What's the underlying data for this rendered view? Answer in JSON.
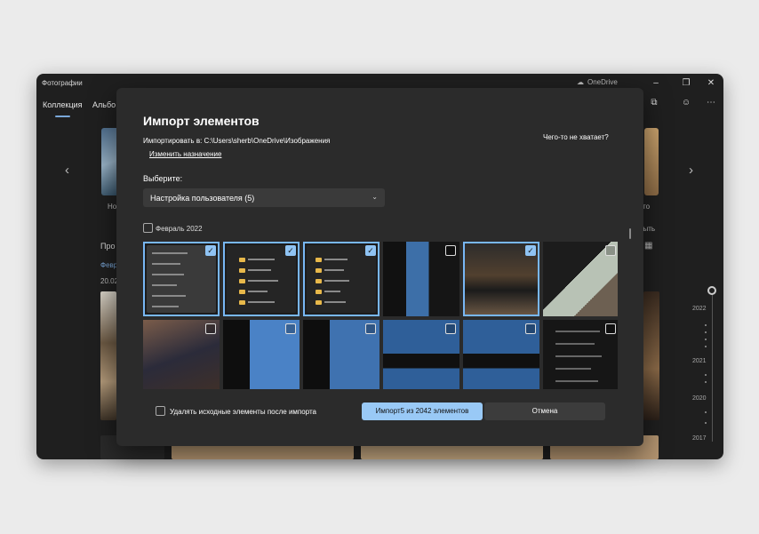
{
  "app": {
    "title": "Фотографии",
    "cloud_label": "OneDrive",
    "tabs": [
      {
        "label": "Коллекция",
        "active": true
      },
      {
        "label": "Альбо"
      }
    ],
    "strip": {
      "left_caption": "Но",
      "right_caption": "то"
    },
    "section_label": "Про",
    "month_link": "Февр",
    "date_label": "20.02",
    "view_label": "рыть",
    "timeline_years": [
      "2022",
      "2021",
      "2020",
      "2017"
    ]
  },
  "dialog": {
    "title": "Импорт элементов",
    "destination_label": "Импортировать в:",
    "destination_path": "C:\\Users\\sherb\\OneDrive\\Изображения",
    "change_link": "Изменить назначение",
    "missing_link": "Чего-то не хватает?",
    "select_label": "Выберите:",
    "select_value": "Настройка пользователя (5)",
    "group_label": "Февраль 2022",
    "delete_label": "Удалять исходные элементы после импорта",
    "import_button": "Импорт5 из 2042 элементов",
    "cancel_button": "Отмена"
  },
  "thumbnails": [
    {
      "kind": "menu",
      "checked": true
    },
    {
      "kind": "folders",
      "checked": true
    },
    {
      "kind": "folders",
      "checked": true
    },
    {
      "kind": "screens",
      "checked": false
    },
    {
      "kind": "screens",
      "checked": true
    },
    {
      "kind": "photos",
      "checked": false
    },
    {
      "kind": "homescreen",
      "checked": false
    },
    {
      "kind": "bluelist",
      "checked": false
    },
    {
      "kind": "bluelist",
      "checked": false
    },
    {
      "kind": "appui",
      "checked": false
    },
    {
      "kind": "appui",
      "checked": false
    },
    {
      "kind": "chat",
      "checked": false
    }
  ],
  "colors": {
    "accent": "#99c9f6",
    "selection_outline": "#78b7f5",
    "dialog_bg": "#2b2b2b",
    "window_bg": "#1f1f1f"
  }
}
